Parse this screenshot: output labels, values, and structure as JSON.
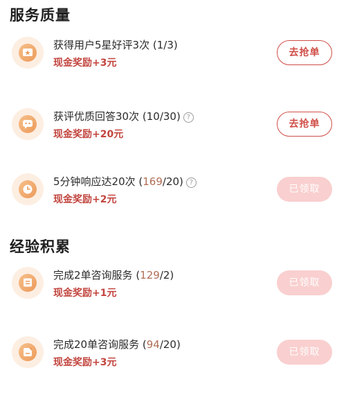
{
  "sections": [
    {
      "title": "服务质量",
      "tasks": [
        {
          "icon": "star-chat-icon",
          "title": "获得用户5星好评3次",
          "progress_open": " (",
          "progress_current": "1",
          "progress_total": "/3)",
          "has_help": false,
          "reward": "现金奖励+3元",
          "button": "去抢单",
          "button_state": "grab"
        },
        {
          "icon": "chat-bubble-icon",
          "title": "获评优质回答30次",
          "progress_open": " (",
          "progress_current": "10",
          "progress_total": "/30)",
          "has_help": true,
          "reward": "现金奖励+20元",
          "button": "去抢单",
          "button_state": "grab"
        },
        {
          "icon": "clock-icon",
          "title": "5分钟响应达20次",
          "progress_open": " (",
          "progress_current": "169",
          "progress_total": "/20)",
          "has_help": true,
          "reward": "现金奖励+2元",
          "button": "已领取",
          "button_state": "claimed"
        }
      ]
    },
    {
      "title": "经验积累",
      "tasks": [
        {
          "icon": "consult-doc-icon",
          "title": "完成2单咨询服务",
          "progress_open": " (",
          "progress_current": "129",
          "progress_total": "/2)",
          "has_help": false,
          "reward": "现金奖励+1元",
          "button": "已领取",
          "button_state": "claimed"
        },
        {
          "icon": "consult-note-icon",
          "title": "完成20单咨询服务",
          "progress_open": " (",
          "progress_current": "94",
          "progress_total": "/20)",
          "has_help": false,
          "reward": "现金奖励+3元",
          "button": "已领取",
          "button_state": "claimed"
        }
      ]
    }
  ],
  "help_glyph": "?"
}
